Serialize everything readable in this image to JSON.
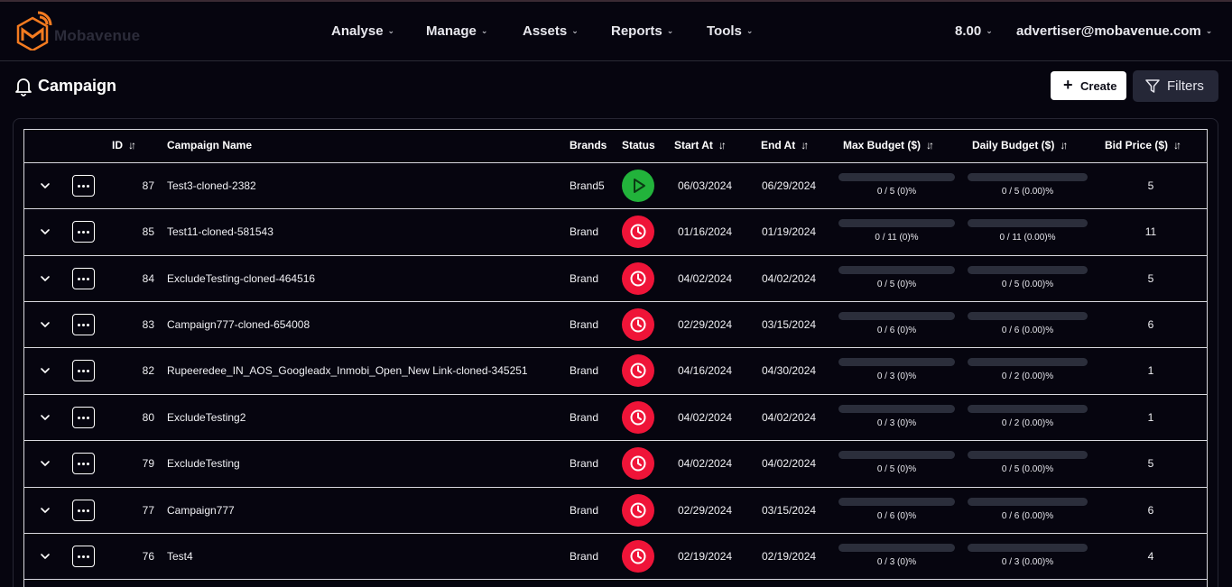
{
  "app": {
    "logo_text": "Mobavenue",
    "nav": [
      {
        "label": "Analyse"
      },
      {
        "label": "Manage"
      },
      {
        "label": "Assets"
      },
      {
        "label": "Reports"
      },
      {
        "label": "Tools"
      }
    ],
    "balance": "8.00",
    "user_email": "advertiser@mobavenue.com"
  },
  "page": {
    "title": "Campaign",
    "create_label": "Create",
    "filters_label": "Filters"
  },
  "table": {
    "columns": {
      "id": "ID",
      "name": "Campaign Name",
      "brands": "Brands",
      "status": "Status",
      "start": "Start At",
      "end": "End At",
      "max_budget": "Max Budget ($)",
      "daily_budget": "Daily Budget ($)",
      "bid_price": "Bid Price ($)"
    },
    "rows": [
      {
        "id": "87",
        "name": "Test3-cloned-2382",
        "brand": "Brand5",
        "status": "running",
        "start": "06/03/2024",
        "end": "06/29/2024",
        "max_budget_text": "0 / 5 (0)%",
        "max_budget_pct": 0,
        "daily_budget_text": "0 / 5 (0.00)%",
        "daily_budget_pct": 0,
        "bid": "5"
      },
      {
        "id": "85",
        "name": "Test11-cloned-581543",
        "brand": "Brand",
        "status": "scheduled",
        "start": "01/16/2024",
        "end": "01/19/2024",
        "max_budget_text": "0 / 11 (0)%",
        "max_budget_pct": 0,
        "daily_budget_text": "0 / 11 (0.00)%",
        "daily_budget_pct": 0,
        "bid": "11"
      },
      {
        "id": "84",
        "name": "ExcludeTesting-cloned-464516",
        "brand": "Brand",
        "status": "scheduled",
        "start": "04/02/2024",
        "end": "04/02/2024",
        "max_budget_text": "0 / 5 (0)%",
        "max_budget_pct": 0,
        "daily_budget_text": "0 / 5 (0.00)%",
        "daily_budget_pct": 0,
        "bid": "5"
      },
      {
        "id": "83",
        "name": "Campaign777-cloned-654008",
        "brand": "Brand",
        "status": "scheduled",
        "start": "02/29/2024",
        "end": "03/15/2024",
        "max_budget_text": "0 / 6 (0)%",
        "max_budget_pct": 0,
        "daily_budget_text": "0 / 6 (0.00)%",
        "daily_budget_pct": 0,
        "bid": "6"
      },
      {
        "id": "82",
        "name": "Rupeeredee_IN_AOS_Googleadx_Inmobi_Open_New Link-cloned-345251",
        "brand": "Brand",
        "status": "scheduled",
        "start": "04/16/2024",
        "end": "04/30/2024",
        "max_budget_text": "0 / 3 (0)%",
        "max_budget_pct": 0,
        "daily_budget_text": "0 / 2 (0.00)%",
        "daily_budget_pct": 0,
        "bid": "1"
      },
      {
        "id": "80",
        "name": "ExcludeTesting2",
        "brand": "Brand",
        "status": "scheduled",
        "start": "04/02/2024",
        "end": "04/02/2024",
        "max_budget_text": "0 / 3 (0)%",
        "max_budget_pct": 0,
        "daily_budget_text": "0 / 2 (0.00)%",
        "daily_budget_pct": 0,
        "bid": "1"
      },
      {
        "id": "79",
        "name": "ExcludeTesting",
        "brand": "Brand",
        "status": "scheduled",
        "start": "04/02/2024",
        "end": "04/02/2024",
        "max_budget_text": "0 / 5 (0)%",
        "max_budget_pct": 0,
        "daily_budget_text": "0 / 5 (0.00)%",
        "daily_budget_pct": 0,
        "bid": "5"
      },
      {
        "id": "77",
        "name": "Campaign777",
        "brand": "Brand",
        "status": "scheduled",
        "start": "02/29/2024",
        "end": "03/15/2024",
        "max_budget_text": "0 / 6 (0)%",
        "max_budget_pct": 0,
        "daily_budget_text": "0 / 6 (0.00)%",
        "daily_budget_pct": 0,
        "bid": "6"
      },
      {
        "id": "76",
        "name": "Test4",
        "brand": "Brand",
        "status": "scheduled",
        "start": "02/19/2024",
        "end": "02/19/2024",
        "max_budget_text": "0 / 3 (0)%",
        "max_budget_pct": 0,
        "daily_budget_text": "0 / 3 (0.00)%",
        "daily_budget_pct": 0,
        "bid": "4"
      }
    ]
  },
  "colors": {
    "background": "#06050f",
    "running": "#22b33b",
    "scheduled": "#ef1438",
    "logo_accent": "#f47b20"
  }
}
